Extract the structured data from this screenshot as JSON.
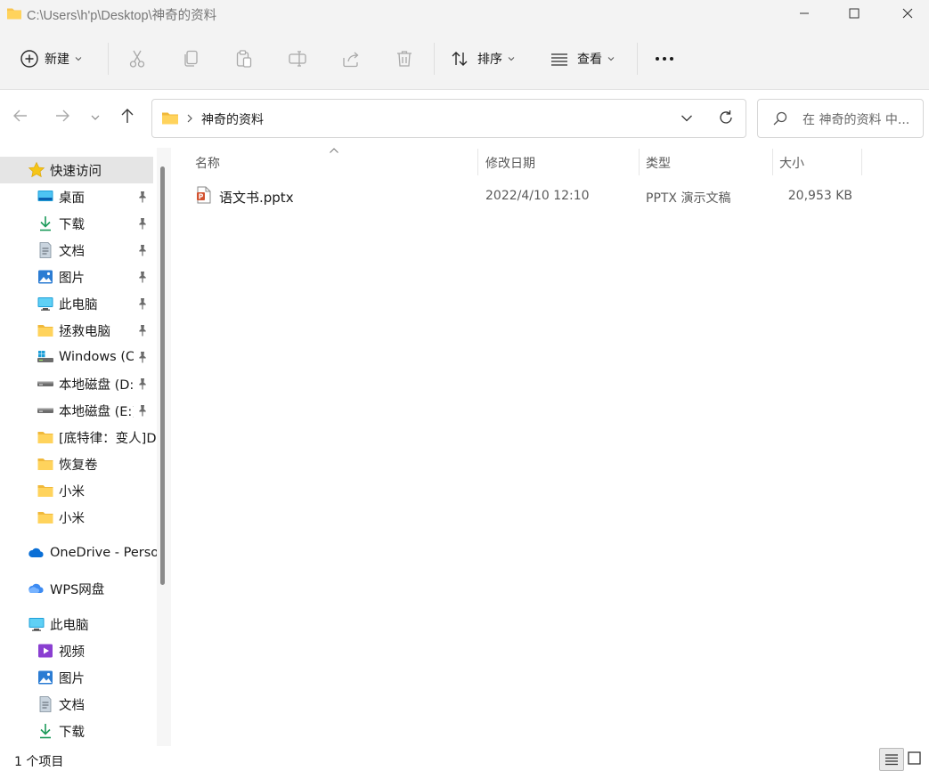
{
  "window": {
    "title": "C:\\Users\\h'p\\Desktop\\神奇的资料"
  },
  "toolbar": {
    "new_label": "新建",
    "sort_label": "排序",
    "view_label": "查看",
    "more_label": "···"
  },
  "address": {
    "crumb": "神奇的资料",
    "search_placeholder": "在 神奇的资料 中..."
  },
  "nav": {
    "quick_access": "快速访问",
    "quick_items": [
      {
        "label": "桌面",
        "icon": "desktop-icon",
        "pinned": true
      },
      {
        "label": "下载",
        "icon": "download-icon",
        "pinned": true
      },
      {
        "label": "文档",
        "icon": "document-icon",
        "pinned": true
      },
      {
        "label": "图片",
        "icon": "pictures-icon",
        "pinned": true
      },
      {
        "label": "此电脑",
        "icon": "computer-icon",
        "pinned": true
      },
      {
        "label": "拯救电脑",
        "icon": "folder-icon",
        "pinned": true
      },
      {
        "label": "Windows (C",
        "icon": "windows-drive-icon",
        "pinned": true
      },
      {
        "label": "本地磁盘 (D:)",
        "icon": "drive-icon",
        "pinned": true
      },
      {
        "label": "本地磁盘 (E:)",
        "icon": "drive-icon",
        "pinned": true
      },
      {
        "label": "[底特律：变人]D",
        "icon": "folder-icon",
        "pinned": false
      },
      {
        "label": "恢复卷",
        "icon": "folder-icon",
        "pinned": false
      },
      {
        "label": "小米",
        "icon": "folder-icon",
        "pinned": false
      },
      {
        "label": "小米",
        "icon": "folder-icon",
        "pinned": false
      }
    ],
    "onedrive": "OneDrive - Perso",
    "wps": "WPS网盘",
    "this_pc": "此电脑",
    "pc_items": [
      {
        "label": "视频",
        "icon": "videos-icon"
      },
      {
        "label": "图片",
        "icon": "pictures-icon"
      },
      {
        "label": "文档",
        "icon": "document-icon"
      },
      {
        "label": "下载",
        "icon": "download-icon"
      }
    ]
  },
  "columns": {
    "name": "名称",
    "modified": "修改日期",
    "type": "类型",
    "size": "大小"
  },
  "files": [
    {
      "name": "语文书.pptx",
      "modified": "2022/4/10 12:10",
      "type": "PPTX 演示文稿",
      "size": "20,953 KB"
    }
  ],
  "status": {
    "count": "1 个项目"
  },
  "colors": {
    "accent": "#0067c0",
    "folder": "#f8c44f",
    "selected_bg": "#e5e5e5",
    "ppt": "#d35230"
  }
}
